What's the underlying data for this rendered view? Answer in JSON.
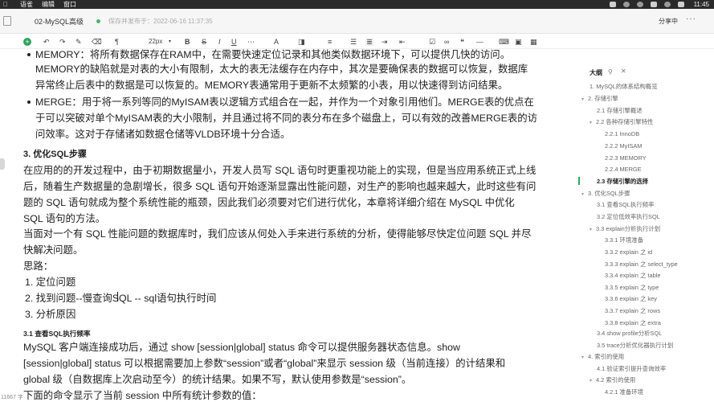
{
  "menubar": {
    "items": [
      "语雀",
      "编辑",
      "窗口"
    ],
    "clock": "11:45"
  },
  "titlebar": {
    "doc_title": "02-MySQL高级",
    "saved": "保存并发布于：2022-06-16 11:37:35",
    "share": "分享中",
    "more": "···"
  },
  "toolbar": {
    "font_size": "22px",
    "icons": [
      "plus-icon",
      "undo-icon",
      "redo-icon",
      "format-painter-icon",
      "clear-format-icon",
      "heading-icon",
      "font-size-select",
      "bold-icon",
      "strikethrough-icon",
      "italic-icon",
      "underline-icon",
      "more-format-icon",
      "text-color-icon",
      "highlight-icon",
      "align-icon",
      "unordered-list-icon",
      "ordered-list-icon",
      "indent-icon",
      "outdent-icon",
      "checkbox-icon",
      "link-icon",
      "quote-icon",
      "divider-icon",
      "code-icon",
      "image-icon",
      "table-icon"
    ]
  },
  "content": {
    "lines": [
      "MEMORY：将所有数据保存在RAM中，在需要快速定位记录和其他类似数据环境下，可以提供几快的访问。",
      "MEMORY的缺陷就是对表的大小有限制，太大的表无法缓存在内存中，其次是要确保表的数据可以恢复，数据库",
      "异常终止后表中的数据是可以恢复的。MEMORY表通常用于更新不太频繁的小表，用以快速得到访问结果。",
      "MERGE：用于将一系列等同的MyISAM表以逻辑方式组合在一起，并作为一个对象引用他们。MERGE表的优点在",
      "于可以突破对单个MyISAM表的大小限制，并且通过将不同的表分布在多个磁盘上，可以有效的改善MERGE表的访",
      "问效率。这对于存储诸如数据仓储等VLDB环境十分合适。",
      "3. 优化SQL步骤",
      "在应用的的开发过程中，由于初期数据量小，开发人员写 SQL 语句时更重视功能上的实现，但是当应用系统正式上线",
      "后，随着生产数据量的急剧增长，很多 SQL 语句开始逐渐显露出性能问题，对生产的影响也越来越大，此时这些有问",
      "题的 SQL 语句就成为整个系统性能的瓶颈，因此我们必须要对它们进行优化，本章将详细介绍在 MySQL 中优化",
      "SQL 语句的方法。",
      "当面对一个有 SQL 性能问题的数据库时，我们应该从何处入手来进行系统的分析，使得能够尽快定位问题 SQL 并尽",
      "快解决问题。",
      "思路：",
      "1. 定位问题",
      "2. 找到问题--慢查询SQL -- sql语句执行时间",
      "3. 分析原因",
      "3.1 查看SQL执行频率",
      "MySQL 客户端连接成功后，通过 show [session|global] status 命令可以提供服务器状态信息。show",
      "[session|global] status 可以根据需要加上参数“session”或者“global”来显示 session 级（当前连接）的计结果和",
      "global 级（自数据库上次启动至今）的统计结果。如果不写，默认使用参数是“session”。",
      "下面的命令显示了当前 session 中所有统计参数的值："
    ],
    "word_count": "11667 字"
  },
  "outline": {
    "title": "大纲",
    "items": [
      "1. MySQL的体系结构概览",
      "2. 存储引擎",
      "2.1 存储引擎概述",
      "2.2 各种存储引擎特性",
      "2.2.1 InnoDB",
      "2.2.2 MyISAM",
      "2.2.3 MEMORY",
      "2.2.4 MERGE",
      "2.3 存储引擎的选择",
      "3. 优化SQL步骤",
      "3.1 查看SQL执行频率",
      "3.2 定位低效率执行SQL",
      "3.3 explain分析执行计划",
      "3.3.1 环境准备",
      "3.3.2 explain 之 id",
      "3.3.3 explain 之 select_type",
      "3.3.4 explain 之 table",
      "3.3.5 explain 之 type",
      "3.3.6 explain 之 key",
      "3.3.7 explain 之 rows",
      "3.3.8 explain 之 extra",
      "3.4 show profile分析SQL",
      "3.5 trace分析优化器执行计划",
      "4. 索引的使用",
      "4.1 验证索引提升查询效率",
      "4.2 索引的使用",
      "4.2.1 准备环境"
    ]
  },
  "colors": {
    "accent": "#2ea45f",
    "menubar_bg": "#2a2a2a"
  }
}
